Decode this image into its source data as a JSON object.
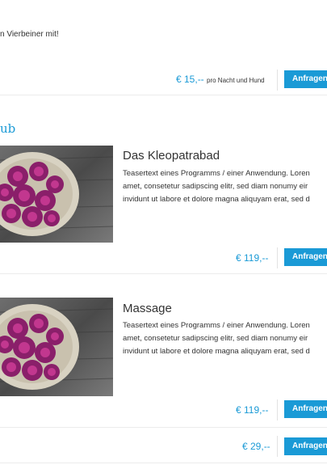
{
  "intro": {
    "text": "n Vierbeiner mit!",
    "price": "€ 15,--",
    "price_note": "pro Nacht und Hund",
    "button": "Anfragen"
  },
  "section": {
    "heading": "ub"
  },
  "cards": [
    {
      "title": "Das Kleopatrabad",
      "teaser_lines": [
        "Teasertext eines Programms / einer Anwendung. Loren",
        "amet, consetetur sadipscing elitr, sed diam nonumy eir",
        "invidunt ut labore et dolore magna aliquyam erat, sed d"
      ],
      "price": "€ 119,--",
      "button": "Anfragen"
    },
    {
      "title": "Massage",
      "teaser_lines": [
        "Teasertext eines Programms / einer Anwendung. Loren",
        "amet, consetetur sadipscing elitr, sed diam nonumy eir",
        "invidunt ut labore et dolore magna aliquyam erat, sed d"
      ],
      "price": "€ 119,--",
      "button": "Anfragen"
    }
  ],
  "footer_row": {
    "price": "€ 29,--",
    "button": "Anfragen"
  },
  "colors": {
    "accent": "#1a9ad6",
    "text": "#333333",
    "divider": "#e2e2e2"
  },
  "icons": {
    "card_image": "purple-flower-bowl-image"
  }
}
